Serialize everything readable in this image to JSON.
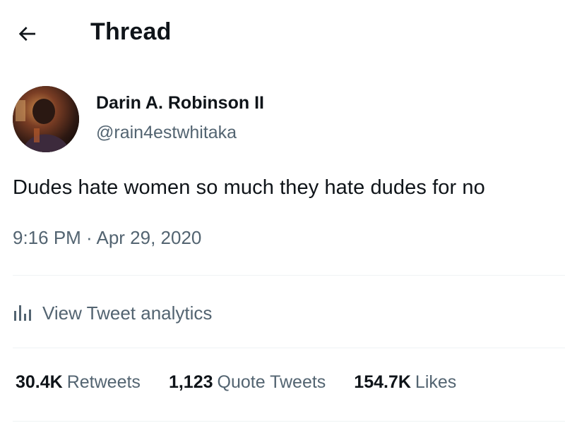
{
  "header": {
    "back_icon": "arrow-left-icon",
    "title": "Thread"
  },
  "author": {
    "name": "Darin A. Robinson II",
    "handle": "@rain4estwhitaka"
  },
  "tweet": {
    "text": "Dudes hate women so much they hate dudes for no",
    "timestamp": "9:16 PM · Apr 29, 2020"
  },
  "analytics": {
    "icon": "bar-chart-icon",
    "label": "View Tweet analytics"
  },
  "stats": {
    "retweets_value": "30.4K",
    "retweets_label": "Retweets",
    "quotes_value": "1,123",
    "quotes_label": "Quote Tweets",
    "likes_value": "154.7K",
    "likes_label": "Likes"
  },
  "colors": {
    "text_primary": "#0f1419",
    "text_secondary": "#536471",
    "divider": "#eff3f4",
    "background": "#ffffff"
  }
}
